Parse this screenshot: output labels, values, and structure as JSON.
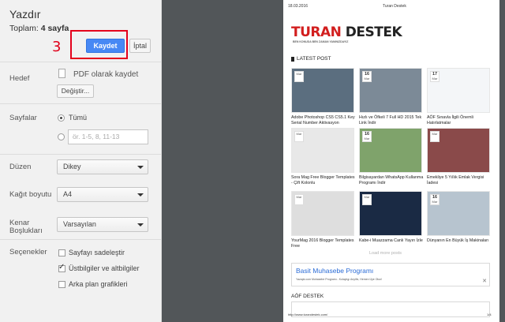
{
  "settings": {
    "title": "Yazdır",
    "total_label": "Toplam:",
    "total_value": "4 sayfa",
    "annotation_number": "3",
    "save_label": "Kaydet",
    "cancel_label": "İptal",
    "destination": {
      "label": "Hedef",
      "value": "PDF olarak kaydet",
      "change_label": "Değiştir..."
    },
    "pages": {
      "label": "Sayfalar",
      "all_label": "Tümü",
      "custom_placeholder": "ör. 1-5, 8, 11-13"
    },
    "layout": {
      "label": "Düzen",
      "value": "Dikey"
    },
    "paper_size": {
      "label": "Kağıt boyutu",
      "value": "A4"
    },
    "margins": {
      "label_line1": "Kenar",
      "label_line2": "Boşlukları",
      "value": "Varsayılan"
    },
    "options": {
      "label": "Seçenekler",
      "items": [
        {
          "label": "Sayfayı sadeleştir",
          "checked": false
        },
        {
          "label": "Üstbilgiler ve altbilgiler",
          "checked": true
        },
        {
          "label": "Arka plan grafikleri",
          "checked": false
        }
      ]
    }
  },
  "preview": {
    "header_date": "18.03.2016",
    "header_site": "Turan Destek",
    "logo_part1": "TURAN",
    "logo_part2": "DESTEK",
    "logo_tagline": "BEN KONUDA BEN ZAMAN YANINIZDAYIZ",
    "latest_label": "LATEST POST",
    "posts": [
      {
        "title": "Adobe Photoshop CS5 CS5.1 Key Serial Number Aktivasyon",
        "badge_month": "Mar",
        "badge_day": "",
        "thumb_color": "#5b6e7f"
      },
      {
        "title": "Hızlı ve Öfkeli 7 Full HD 2015 Tek Link İndir",
        "badge_month": "Mar",
        "badge_day": "16",
        "thumb_color": "#7c8a97"
      },
      {
        "title": "AÖF Sınavla İlgili Önemli Hatırlatmalar",
        "badge_month": "Mar",
        "badge_day": "17",
        "thumb_color": "#f4f6f8"
      },
      {
        "title": "Sora Mag Free Blogger Templates - Çift Kolonlu",
        "badge_month": "Mar",
        "badge_day": "",
        "thumb_color": "#e8e8e8"
      },
      {
        "title": "Bilgisayardan WhatsApp Kullanma Programı İndir",
        "badge_month": "Mar",
        "badge_day": "16",
        "thumb_color": "#7fa36b"
      },
      {
        "title": "Emekliye 5 Yıllık Emlak Vergisi İadesi",
        "badge_month": "Mar",
        "badge_day": "",
        "thumb_color": "#8a4a4a"
      },
      {
        "title": "YourMag 2016 Blogger Templates Free",
        "badge_month": "Mar",
        "badge_day": "",
        "thumb_color": "#dedede"
      },
      {
        "title": "Kabe-i Muazzama Canlı Yayın İzle",
        "badge_month": "Mar",
        "badge_day": "",
        "thumb_color": "#1a2a44"
      },
      {
        "title": "Dünyanın En Büyük İş Makinaları",
        "badge_month": "Mar",
        "badge_day": "16",
        "thumb_color": "#b7c4cf"
      }
    ],
    "load_more": "Load more posts",
    "ad_title": "Basit Muhasebe Programı",
    "ad_url": "Yazapk.com Muhasebe Programı - Kolaylıgı Anyifix, Hemen Üye Olun!",
    "section2_label": "AÖF DESTEK",
    "footer_url": "http://www.turandestek.com/",
    "footer_page": "1/4"
  }
}
